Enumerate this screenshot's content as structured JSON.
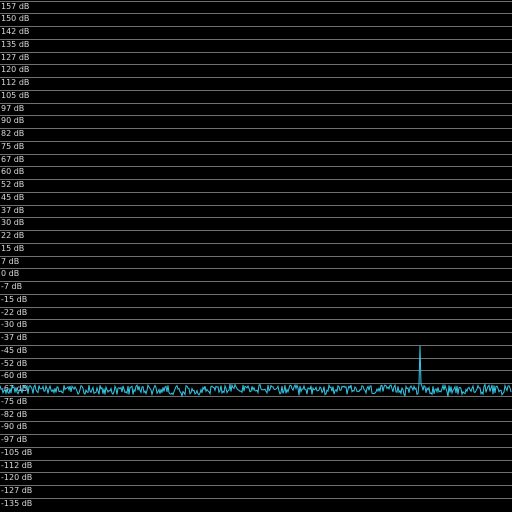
{
  "spectrum": {
    "unit": "dB",
    "db_max": 157.5,
    "db_per_division": 7.5,
    "labels": [
      "157 dB",
      "150 dB",
      "142 dB",
      "135 dB",
      "127 dB",
      "120 dB",
      "112 dB",
      "105 dB",
      "97 dB",
      "90 dB",
      "82 dB",
      "75 dB",
      "67 dB",
      "60 dB",
      "52 dB",
      "45 dB",
      "37 dB",
      "30 dB",
      "22 dB",
      "15 dB",
      "7 dB",
      "0 dB",
      "-7 dB",
      "-15 dB",
      "-22 dB",
      "-30 dB",
      "-37 dB",
      "-45 dB",
      "-52 dB",
      "-60 dB",
      "-67 dB",
      "-75 dB",
      "-82 dB",
      "-90 dB",
      "-97 dB",
      "-105 dB",
      "-112 dB",
      "-120 dB",
      "-127 dB",
      "-135 dB"
    ],
    "noise_floor_db": -71.5,
    "noise_amplitude_db": 2.8,
    "peak": {
      "position_fraction": 0.82,
      "level_db": -45.5
    },
    "colors": {
      "background": "#000000",
      "grid": "#6f6f6f",
      "label": "#d8d8d8",
      "trace": "#35c7e6"
    }
  }
}
